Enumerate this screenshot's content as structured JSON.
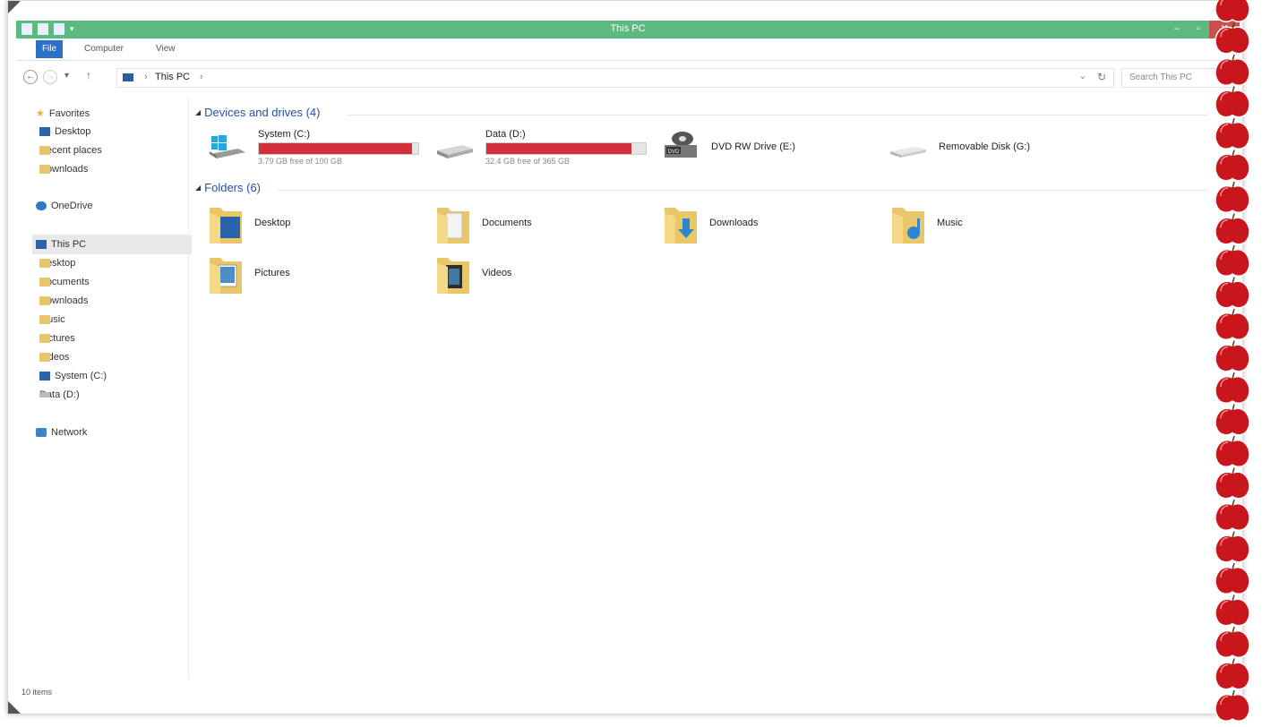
{
  "window": {
    "title": "This PC",
    "ribbon_tabs": {
      "file": "File",
      "computer": "Computer",
      "view": "View"
    },
    "address": {
      "crumb": "This PC"
    },
    "search": {
      "placeholder": "Search This PC"
    },
    "status": "10 items"
  },
  "sidebar": {
    "favorites": {
      "label": "Favorites",
      "items": [
        "Desktop",
        "Recent places",
        "Downloads"
      ]
    },
    "onedrive": "OneDrive",
    "thispc": {
      "label": "This PC",
      "items": [
        "Desktop",
        "Documents",
        "Downloads",
        "Music",
        "Pictures",
        "Videos",
        "System (C:)",
        "Data (D:)"
      ]
    },
    "network": "Network"
  },
  "content": {
    "devices_header": "Devices and drives (4)",
    "folders_header": "Folders (6)",
    "drives": [
      {
        "name": "System (C:)",
        "free": "3.79 GB free of 100 GB",
        "used_fraction": 0.962
      },
      {
        "name": "Data (D:)",
        "free": "32.4 GB free of 365 GB",
        "used_fraction": 0.911
      },
      {
        "name": "DVD RW Drive (E:)"
      },
      {
        "name": "Removable Disk (G:)"
      }
    ],
    "folders": [
      "Desktop",
      "Documents",
      "Downloads",
      "Music",
      "Pictures",
      "Videos"
    ]
  },
  "colors": {
    "titlebar": "#5cba80",
    "file_tab": "#2a72c8",
    "usage_bar": "#d4303a",
    "apple": "#c8161c"
  },
  "icons": {
    "drive_c": "windows-drive-icon",
    "drive_d": "hard-disk-icon",
    "drive_e": "dvd-drive-icon",
    "drive_g": "removable-disk-icon",
    "border": "apple-icon"
  }
}
